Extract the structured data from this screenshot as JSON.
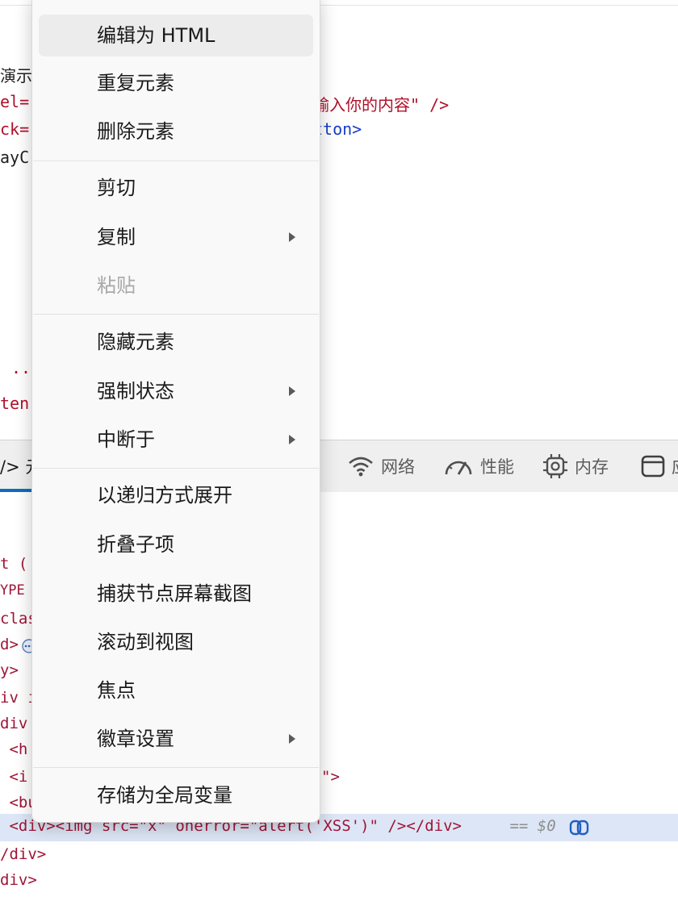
{
  "source_panel": {
    "line1": "演示",
    "line2_left": "el=",
    "line2_right": "输入你的内容\" />",
    "line3_left": "ck=",
    "line3_right": "tton>",
    "line4": "ayC",
    "line5": "..",
    "line6": "ten"
  },
  "toolbar": {
    "elements_tab_partial": "/> 元",
    "network_label": "网络",
    "performance_label": "性能",
    "memory_label": "内存",
    "app_label_partial": "应"
  },
  "dom_lines": [
    "t (",
    "YPE",
    "clas",
    "d>",
    "y>",
    "iv i",
    "div",
    " <h",
    " <i",
    " <bu",
    "\">"
  ],
  "selected_dom_line": {
    "open": " <div><img src=\"x\" onerror=\"alert('XSS')\" /></div>",
    "marker": " == $0"
  },
  "dom_after": [
    "/div>",
    "div>"
  ],
  "context_menu": {
    "items": [
      {
        "label": "编辑为 HTML"
      },
      {
        "label": "重复元素"
      },
      {
        "label": "删除元素"
      },
      {
        "label": "剪切"
      },
      {
        "label": "复制"
      },
      {
        "label": "粘贴"
      },
      {
        "label": "隐藏元素"
      },
      {
        "label": "强制状态"
      },
      {
        "label": "中断于"
      },
      {
        "label": "以递归方式展开"
      },
      {
        "label": "折叠子项"
      },
      {
        "label": "捕获节点屏幕截图"
      },
      {
        "label": "滚动到视图"
      },
      {
        "label": "焦点"
      },
      {
        "label": "徽章设置"
      },
      {
        "label": "存储为全局变量"
      }
    ]
  },
  "colors": {
    "selection_bg": "#dde6f6",
    "tab_accent": "#0f6cbd",
    "code_red": "#b0102a",
    "code_blue": "#1a3cc9"
  },
  "icons": [
    "wifi-icon",
    "gauge-icon",
    "chip-icon",
    "window-icon",
    "ellipsis-icon",
    "copilot-icon",
    "submenu-arrow-icon"
  ]
}
